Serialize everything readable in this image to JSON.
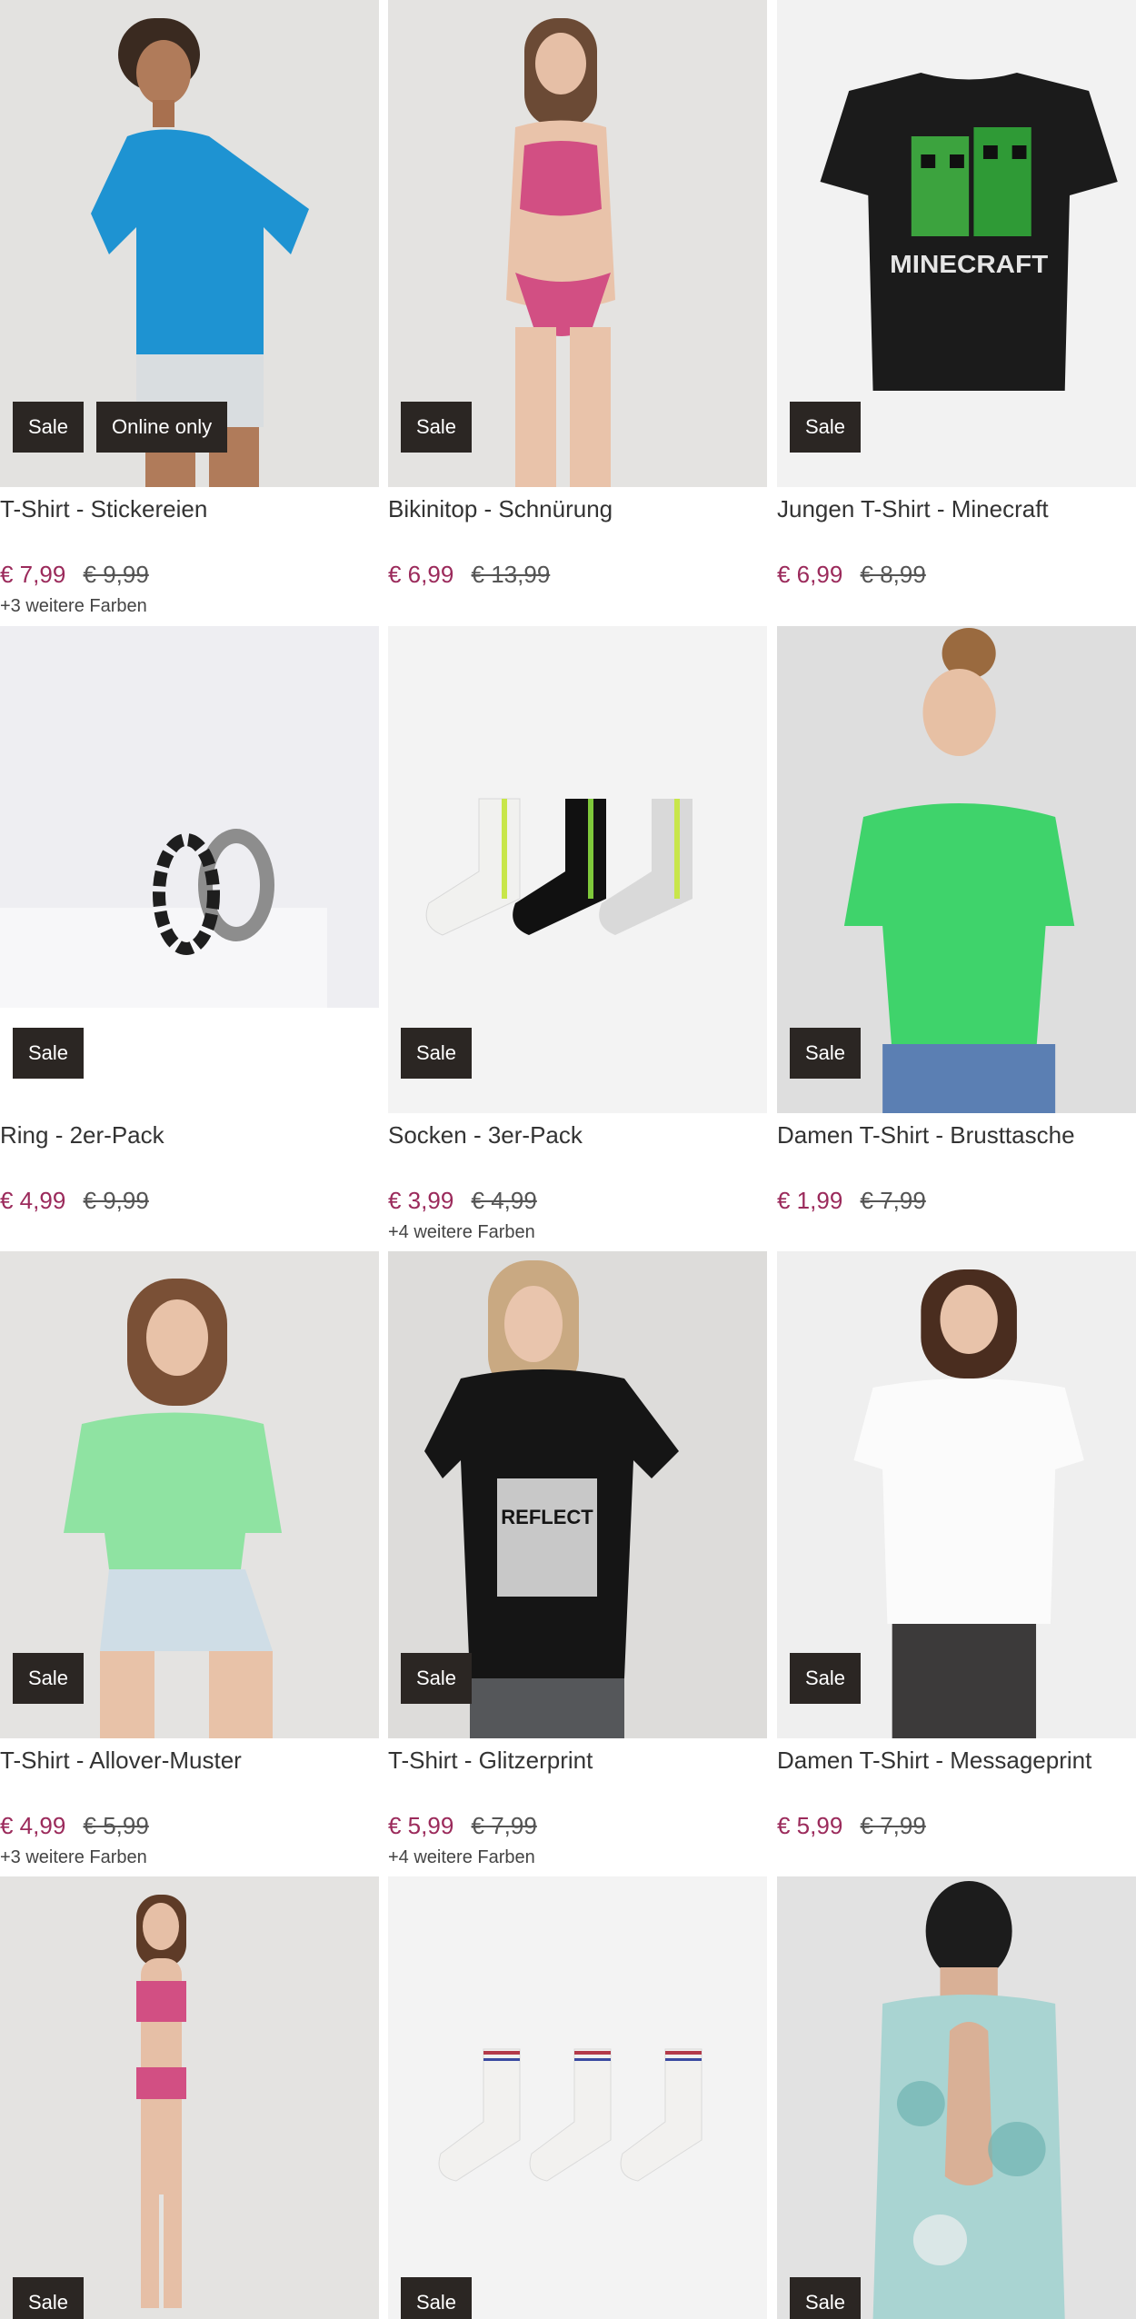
{
  "products": [
    {
      "title": "T-Shirt - Stickereien",
      "price": "€ 7,99",
      "old_price": "€ 9,99",
      "colors": "+3 weitere Farben",
      "badges": [
        "Sale",
        "Online only"
      ]
    },
    {
      "title": "Bikinitop - Schnürung",
      "price": "€ 6,99",
      "old_price": "€ 13,99",
      "colors": "",
      "badges": [
        "Sale"
      ]
    },
    {
      "title": "Jungen T-Shirt - Minecraft",
      "price": "€ 6,99",
      "old_price": "€ 8,99",
      "colors": "",
      "badges": [
        "Sale"
      ]
    },
    {
      "title": "Ring - 2er-Pack",
      "price": "€ 4,99",
      "old_price": "€ 9,99",
      "colors": "",
      "badges": [
        "Sale"
      ]
    },
    {
      "title": "Socken - 3er-Pack",
      "price": "€ 3,99",
      "old_price": "€ 4,99",
      "colors": "+4 weitere Farben",
      "badges": [
        "Sale"
      ]
    },
    {
      "title": "Damen T-Shirt - Brusttasche",
      "price": "€ 1,99",
      "old_price": "€ 7,99",
      "colors": "",
      "badges": [
        "Sale"
      ]
    },
    {
      "title": "T-Shirt - Allover-Muster",
      "price": "€ 4,99",
      "old_price": "€ 5,99",
      "colors": "+3 weitere Farben",
      "badges": [
        "Sale"
      ]
    },
    {
      "title": "T-Shirt - Glitzerprint",
      "price": "€ 5,99",
      "old_price": "€ 7,99",
      "colors": "+4 weitere Farben",
      "badges": [
        "Sale"
      ]
    },
    {
      "title": "Damen T-Shirt - Messageprint",
      "price": "€ 5,99",
      "old_price": "€ 7,99",
      "colors": "",
      "badges": [
        "Sale"
      ]
    },
    {
      "title": "",
      "price": "",
      "old_price": "",
      "colors": "",
      "badges": [
        "Sale"
      ]
    },
    {
      "title": "",
      "price": "",
      "old_price": "",
      "colors": "",
      "badges": [
        "Sale"
      ]
    },
    {
      "title": "",
      "price": "",
      "old_price": "",
      "colors": "",
      "badges": [
        "Sale"
      ]
    }
  ],
  "artwork": {
    "minecraft_print": "MINECRAFT",
    "glitter_print": "REFLECT"
  },
  "colors": {
    "price_now": "#9b2a5b",
    "badge_bg": "#2b2623"
  }
}
